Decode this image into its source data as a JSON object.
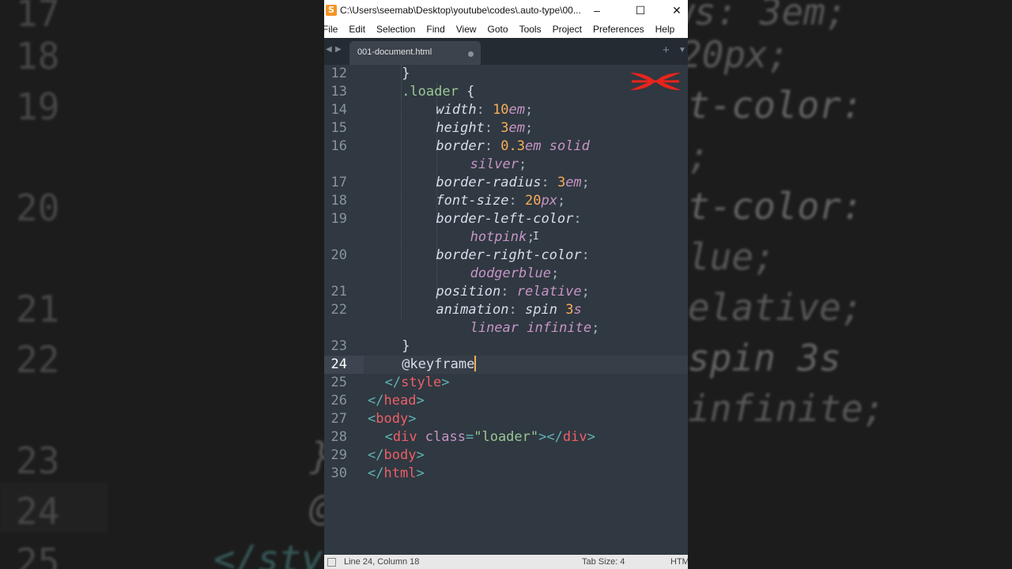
{
  "window": {
    "title": "C:\\Users\\seemab\\Desktop\\youtube\\codes\\.auto-type\\00...",
    "app_icon": "S",
    "minimize_icon": "–",
    "maximize_icon": "☐",
    "close_icon": "✕"
  },
  "menu": [
    "File",
    "Edit",
    "Selection",
    "Find",
    "View",
    "Goto",
    "Tools",
    "Project",
    "Preferences",
    "Help"
  ],
  "tabs": [
    {
      "label": "001-document.html"
    }
  ],
  "tab_controls": {
    "prev": "◀",
    "next": "▶",
    "new": "+",
    "dropdown": "▼"
  },
  "editor": {
    "lines": [
      {
        "num": "12",
        "indent": 4,
        "tokens": [
          {
            "t": "}",
            "c": "#d8dee9"
          }
        ]
      },
      {
        "num": "13",
        "indent": 4,
        "tokens": [
          {
            "t": ".loader",
            "c": "#99c794"
          },
          {
            "t": " {",
            "c": "#d8dee9"
          }
        ]
      },
      {
        "num": "14",
        "indent": 8,
        "tokens": [
          {
            "t": "width",
            "c": "#d8dee9",
            "i": true
          },
          {
            "t": ": ",
            "c": "#a7b4c0"
          },
          {
            "t": "10",
            "c": "#f9ae58"
          },
          {
            "t": "em",
            "c": "#c695c6",
            "i": true
          },
          {
            "t": ";",
            "c": "#a7b4c0"
          }
        ]
      },
      {
        "num": "15",
        "indent": 8,
        "tokens": [
          {
            "t": "height",
            "c": "#d8dee9",
            "i": true
          },
          {
            "t": ": ",
            "c": "#a7b4c0"
          },
          {
            "t": "3",
            "c": "#f9ae58"
          },
          {
            "t": "em",
            "c": "#c695c6",
            "i": true
          },
          {
            "t": ";",
            "c": "#a7b4c0"
          }
        ]
      },
      {
        "num": "16",
        "indent": 8,
        "tokens": [
          {
            "t": "border",
            "c": "#d8dee9",
            "i": true
          },
          {
            "t": ": ",
            "c": "#a7b4c0"
          },
          {
            "t": "0.3",
            "c": "#f9ae58"
          },
          {
            "t": "em solid",
            "c": "#c695c6",
            "i": true
          }
        ]
      },
      {
        "num": "",
        "indent": 12,
        "tokens": [
          {
            "t": "silver",
            "c": "#c695c6",
            "i": true
          },
          {
            "t": ";",
            "c": "#a7b4c0"
          }
        ]
      },
      {
        "num": "17",
        "indent": 8,
        "tokens": [
          {
            "t": "border-radius",
            "c": "#d8dee9",
            "i": true
          },
          {
            "t": ": ",
            "c": "#a7b4c0"
          },
          {
            "t": "3",
            "c": "#f9ae58"
          },
          {
            "t": "em",
            "c": "#c695c6",
            "i": true
          },
          {
            "t": ";",
            "c": "#a7b4c0"
          }
        ]
      },
      {
        "num": "18",
        "indent": 8,
        "tokens": [
          {
            "t": "font-size",
            "c": "#d8dee9",
            "i": true
          },
          {
            "t": ": ",
            "c": "#a7b4c0"
          },
          {
            "t": "20",
            "c": "#f9ae58"
          },
          {
            "t": "px",
            "c": "#c695c6",
            "i": true
          },
          {
            "t": ";",
            "c": "#a7b4c0"
          }
        ]
      },
      {
        "num": "19",
        "indent": 8,
        "tokens": [
          {
            "t": "border-left-color",
            "c": "#d8dee9",
            "i": true
          },
          {
            "t": ":",
            "c": "#a7b4c0"
          }
        ]
      },
      {
        "num": "",
        "indent": 12,
        "tokens": [
          {
            "t": "hotpink",
            "c": "#c695c6",
            "i": true
          },
          {
            "t": ";",
            "c": "#a7b4c0"
          }
        ]
      },
      {
        "num": "20",
        "indent": 8,
        "tokens": [
          {
            "t": "border-right-color",
            "c": "#d8dee9",
            "i": true
          },
          {
            "t": ":",
            "c": "#a7b4c0"
          }
        ]
      },
      {
        "num": "",
        "indent": 12,
        "tokens": [
          {
            "t": "dodgerblue",
            "c": "#c695c6",
            "i": true
          },
          {
            "t": ";",
            "c": "#a7b4c0"
          }
        ]
      },
      {
        "num": "21",
        "indent": 8,
        "tokens": [
          {
            "t": "position",
            "c": "#d8dee9",
            "i": true
          },
          {
            "t": ": ",
            "c": "#a7b4c0"
          },
          {
            "t": "relative",
            "c": "#c695c6",
            "i": true
          },
          {
            "t": ";",
            "c": "#a7b4c0"
          }
        ]
      },
      {
        "num": "22",
        "indent": 8,
        "tokens": [
          {
            "t": "animation",
            "c": "#d8dee9",
            "i": true
          },
          {
            "t": ": ",
            "c": "#a7b4c0"
          },
          {
            "t": "spin ",
            "c": "#d8dee9",
            "i": true
          },
          {
            "t": "3",
            "c": "#f9ae58"
          },
          {
            "t": "s",
            "c": "#c695c6",
            "i": true
          }
        ]
      },
      {
        "num": "",
        "indent": 12,
        "tokens": [
          {
            "t": "linear infinite",
            "c": "#c695c6",
            "i": true
          },
          {
            "t": ";",
            "c": "#a7b4c0"
          }
        ]
      },
      {
        "num": "23",
        "indent": 4,
        "tokens": [
          {
            "t": "}",
            "c": "#d8dee9"
          }
        ]
      },
      {
        "num": "24",
        "indent": 4,
        "current": true,
        "tokens": [
          {
            "t": "@keyframe",
            "c": "#d8dee9"
          }
        ]
      },
      {
        "num": "25",
        "indent": 2,
        "tokens": [
          {
            "t": "</",
            "c": "#5fb3b3"
          },
          {
            "t": "style",
            "c": "#ec5f67"
          },
          {
            "t": ">",
            "c": "#5fb3b3"
          }
        ]
      },
      {
        "num": "26",
        "indent": 0,
        "tokens": [
          {
            "t": "</",
            "c": "#5fb3b3"
          },
          {
            "t": "head",
            "c": "#ec5f67"
          },
          {
            "t": ">",
            "c": "#5fb3b3"
          }
        ]
      },
      {
        "num": "27",
        "indent": 0,
        "tokens": [
          {
            "t": "<",
            "c": "#5fb3b3"
          },
          {
            "t": "body",
            "c": "#ec5f67"
          },
          {
            "t": ">",
            "c": "#5fb3b3"
          }
        ]
      },
      {
        "num": "28",
        "indent": 2,
        "tokens": [
          {
            "t": "<",
            "c": "#5fb3b3"
          },
          {
            "t": "div",
            "c": "#ec5f67"
          },
          {
            "t": " class",
            "c": "#c695c6"
          },
          {
            "t": "=",
            "c": "#5fb3b3"
          },
          {
            "t": "\"loader\"",
            "c": "#99c794"
          },
          {
            "t": "></",
            "c": "#5fb3b3"
          },
          {
            "t": "div",
            "c": "#ec5f67"
          },
          {
            "t": ">",
            "c": "#5fb3b3"
          }
        ]
      },
      {
        "num": "29",
        "indent": 0,
        "tokens": [
          {
            "t": "</",
            "c": "#5fb3b3"
          },
          {
            "t": "body",
            "c": "#ec5f67"
          },
          {
            "t": ">",
            "c": "#5fb3b3"
          }
        ]
      },
      {
        "num": "30",
        "indent": 0,
        "tokens": [
          {
            "t": "</",
            "c": "#5fb3b3"
          },
          {
            "t": "html",
            "c": "#ec5f67"
          },
          {
            "t": ">",
            "c": "#5fb3b3"
          }
        ]
      }
    ]
  },
  "status": {
    "position": "Line 24, Column 18",
    "tab_size": "Tab Size: 4",
    "syntax": "HTM"
  },
  "background_left": [
    {
      "num": "17"
    },
    {
      "num": "18"
    },
    {
      "num": "19"
    },
    {
      "num": "20"
    },
    {
      "num": "21"
    },
    {
      "num": "22"
    },
    {
      "num": "23"
    },
    {
      "num": "24"
    },
    {
      "num": "25"
    }
  ],
  "background_left_code": [
    {
      "text": "}",
      "color": "#8a8a8a"
    },
    {
      "text": "@",
      "color": "#8a8a8a"
    },
    {
      "text": "</sty",
      "color": "#4f8f8f"
    }
  ],
  "background_right": [
    {
      "text": "ws: 3em;",
      "color": "#8a8a8a"
    },
    {
      "text": "20px;",
      "color": "#8a8a8a"
    },
    {
      "text": "t-color:",
      "color": "#a0a0a0"
    },
    {
      "text": ";",
      "color": "#8a8a8a"
    },
    {
      "text": "t-color:",
      "color": "#a0a0a0"
    },
    {
      "text": "lue;",
      "color": "#8a8a8a"
    },
    {
      "text": "elative;",
      "color": "#8a8a8a"
    },
    {
      "text": "spin 3s",
      "color": "#a0a0a0"
    },
    {
      "text": "infinite;",
      "color": "#8a8a8a"
    }
  ],
  "colors": {
    "editor_bg": "#303841",
    "tab_active": "#3b434d",
    "cursor": "#f9ae58",
    "logo": "#e8241c"
  }
}
